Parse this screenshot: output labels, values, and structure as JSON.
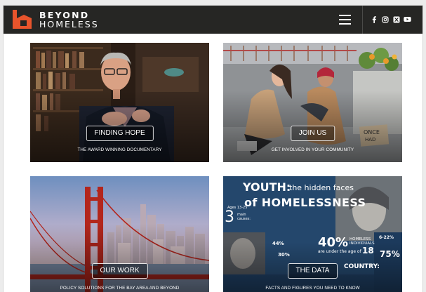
{
  "header": {
    "brand_line1": "BEYOND",
    "brand_line2": "HOMELESS",
    "logo_icon": "house-b-logo",
    "brand_color": "#e8542c",
    "background": "#262624",
    "menu_icon": "hamburger-icon",
    "social_icons": [
      "facebook-icon",
      "instagram-icon",
      "x-icon",
      "youtube-icon"
    ]
  },
  "cards": [
    {
      "button": "FINDING HOPE",
      "caption": "THE AWARD WINNING DOCUMENTARY"
    },
    {
      "button": "JOIN US",
      "caption": "GET INVOLVED IN YOUR COMMUNITY"
    },
    {
      "button": "OUR WORK",
      "caption": "POLICY SOLUTIONS FOR THE BAY AREA AND BEYOND"
    },
    {
      "button": "THE DATA",
      "caption": "FACTS AND FIGURES YOU NEED TO KNOW"
    }
  ],
  "infographic": {
    "title_line1": "YOUTH:",
    "title_line1b": "the hidden faces",
    "title_line2": "of HOMELESSNESS",
    "stat_3": "3",
    "stat_3_label": "main causes:",
    "stat_40": "40%",
    "stat_40_label": "HOMELESS INDIVIDUALS",
    "stat_18_label": "are under the age of",
    "stat_18": "18",
    "stat_75": "75%",
    "stat_6_22": "6-22%",
    "stat_44": "44%",
    "stat_30": "30%",
    "country_label": "COUNTRY:",
    "ages_label": "Ages 13-25"
  }
}
